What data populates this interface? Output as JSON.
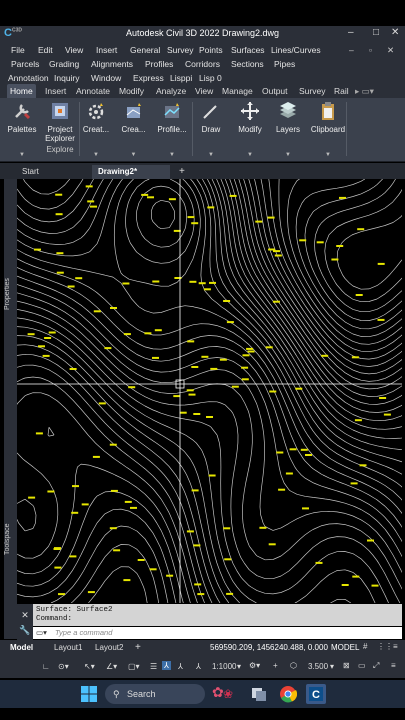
{
  "app": {
    "title": "Autodesk Civil 3D 2022    Drawing2.dwg",
    "logo_text": "C",
    "logo_sub": "C3D"
  },
  "window_controls": [
    "–",
    "□",
    "✕"
  ],
  "menu": {
    "rows": [
      [
        "File",
        "Edit",
        "View",
        "Insert",
        "General",
        "Survey",
        "Points",
        "Surfaces",
        "Lines/Curves"
      ],
      [
        "Parcels",
        "Grading",
        "Alignments",
        "Profiles",
        "Corridors",
        "Sections",
        "Pipes"
      ],
      [
        "Annotation",
        "Inquiry",
        "Window",
        "Express",
        "Lisppi",
        "Lisp 0"
      ]
    ],
    "ctrls": [
      "–",
      "▫",
      "✕"
    ]
  },
  "ribbon_tabs": [
    "Home",
    "Insert",
    "Annotate",
    "Modify",
    "Analyze",
    "View",
    "Manage",
    "Output",
    "Survey",
    "Rail"
  ],
  "ribbon_buttons": [
    {
      "label": "Palettes",
      "icon": "wrench-icon"
    },
    {
      "label": "Project Explorer",
      "icon": "project-explorer-icon"
    },
    {
      "label": "Creat...",
      "icon": "create-gear-icon"
    },
    {
      "label": "Crea...",
      "icon": "create-design-icon"
    },
    {
      "label": "Profile...",
      "icon": "profile-icon"
    },
    {
      "label": "Draw",
      "icon": "pencil-icon"
    },
    {
      "label": "Modify",
      "icon": "move-icon"
    },
    {
      "label": "Layers",
      "icon": "layers-icon"
    },
    {
      "label": "Clipboard",
      "icon": "clipboard-icon"
    }
  ],
  "ribbon_panel_label": "Explore",
  "doc_tabs": [
    "Start",
    "Drawing2*",
    "+"
  ],
  "sidebar": {
    "top": "Properties",
    "bottom": "Toolspace"
  },
  "command": {
    "history_1": "Surface:  Surface2",
    "history_2": "Command:",
    "placeholder": "Type a command"
  },
  "layout_tabs": [
    "Model",
    "Layout1",
    "Layout2",
    "+"
  ],
  "status": {
    "coords": "569590.209, 1456240.488, 0.000",
    "space": "MODEL",
    "scale": "1:1000",
    "lineweight": "3.500"
  },
  "taskbar": {
    "search": "Search"
  },
  "colors": {
    "contour": "#e8e8e8",
    "label": "#e6e600",
    "crosshair": "#ffffff",
    "accent": "#4fb3e8"
  }
}
